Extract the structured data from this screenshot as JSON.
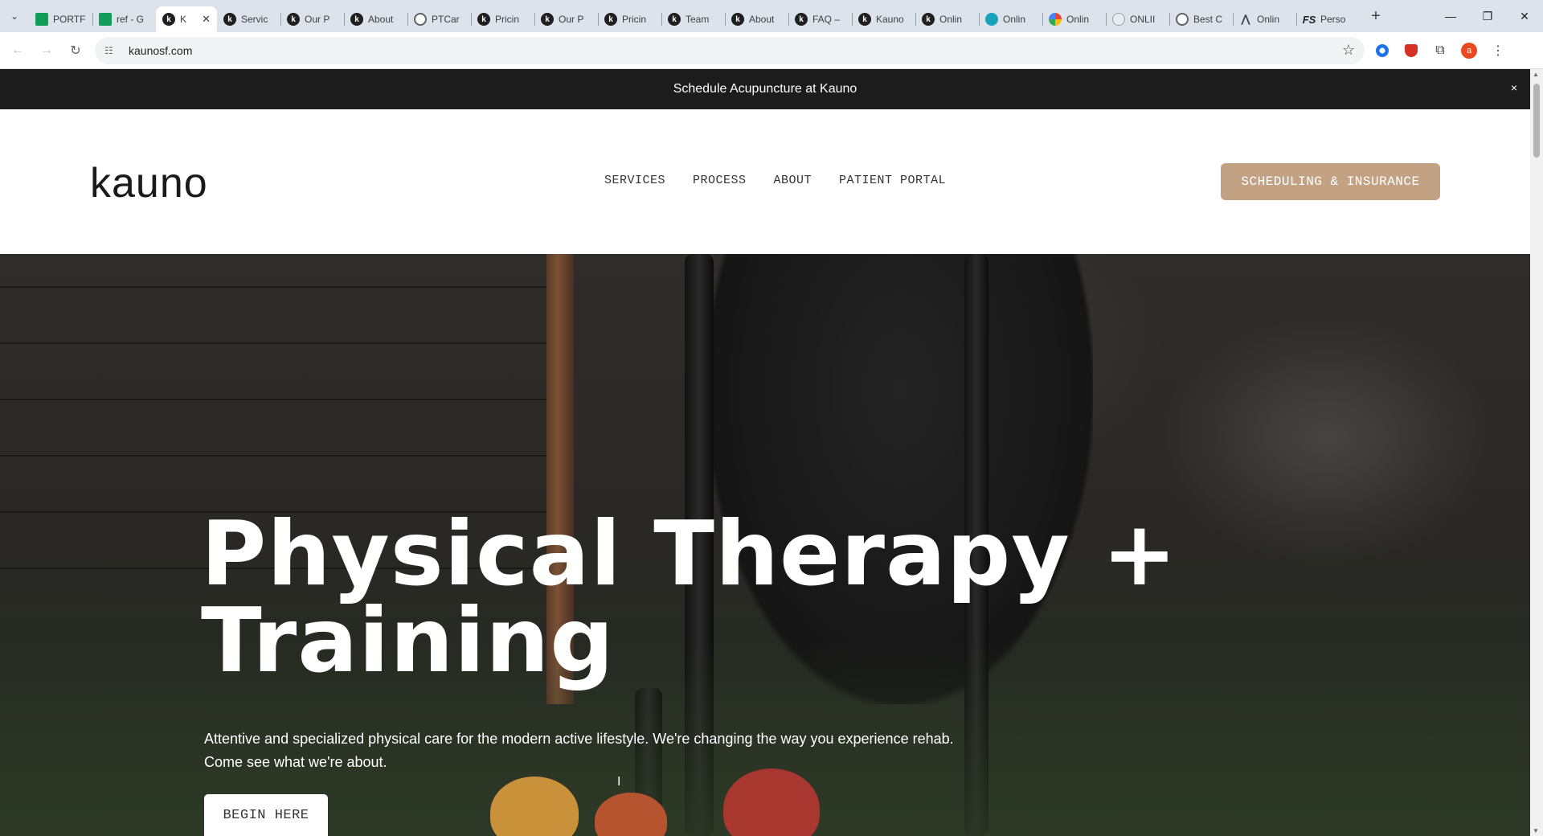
{
  "browser": {
    "tabs": [
      {
        "title": "PORTF",
        "icon": "sheets-icon",
        "iconClass": "ic-sheet",
        "glyph": "",
        "active": false
      },
      {
        "title": "ref - G",
        "icon": "sheets-icon",
        "iconClass": "ic-sheet",
        "glyph": "",
        "active": false
      },
      {
        "title": "K",
        "icon": "kauno-icon",
        "iconClass": "ic-k",
        "glyph": "k",
        "active": true
      },
      {
        "title": "Servic",
        "icon": "kauno-icon",
        "iconClass": "ic-k",
        "glyph": "k",
        "active": false
      },
      {
        "title": "Our P",
        "icon": "kauno-icon",
        "iconClass": "ic-k",
        "glyph": "k",
        "active": false
      },
      {
        "title": "About",
        "icon": "kauno-icon",
        "iconClass": "ic-k",
        "glyph": "k",
        "active": false
      },
      {
        "title": "PTCar",
        "icon": "globe-icon",
        "iconClass": "ic-globe",
        "glyph": "",
        "active": false
      },
      {
        "title": "Pricin",
        "icon": "kauno-icon",
        "iconClass": "ic-k",
        "glyph": "k",
        "active": false
      },
      {
        "title": "Our P",
        "icon": "kauno-icon",
        "iconClass": "ic-k",
        "glyph": "k",
        "active": false
      },
      {
        "title": "Pricin",
        "icon": "kauno-icon",
        "iconClass": "ic-k",
        "glyph": "k",
        "active": false
      },
      {
        "title": "Team",
        "icon": "kauno-icon",
        "iconClass": "ic-k",
        "glyph": "k",
        "active": false
      },
      {
        "title": "About",
        "icon": "kauno-icon",
        "iconClass": "ic-k",
        "glyph": "k",
        "active": false
      },
      {
        "title": "FAQ –",
        "icon": "kauno-icon",
        "iconClass": "ic-k",
        "glyph": "k",
        "active": false
      },
      {
        "title": "Kauno",
        "icon": "kauno-icon",
        "iconClass": "ic-k",
        "glyph": "k",
        "active": false
      },
      {
        "title": "Onlin",
        "icon": "kauno-icon",
        "iconClass": "ic-k",
        "glyph": "k",
        "active": false
      },
      {
        "title": "Onlin",
        "icon": "teal-logo-icon",
        "iconClass": "ic-teal",
        "glyph": "",
        "active": false
      },
      {
        "title": "Onlin",
        "icon": "google-icon",
        "iconClass": "ic-google",
        "glyph": "",
        "active": false
      },
      {
        "title": "ONLII",
        "icon": "grey-logo-icon",
        "iconClass": "ic-grey",
        "glyph": "",
        "active": false
      },
      {
        "title": "Best C",
        "icon": "globe-icon",
        "iconClass": "ic-globe",
        "glyph": "",
        "active": false
      },
      {
        "title": "Onlin",
        "icon": "peak-logo-icon",
        "iconClass": "ic-outline",
        "glyph": "⋀",
        "active": false
      },
      {
        "title": "Perso",
        "icon": "fs-logo-icon",
        "iconClass": "ic-fs",
        "glyph": "FS",
        "active": false
      }
    ],
    "url": "kaunosf.com",
    "profile_initial": "a"
  },
  "announcement": {
    "text": "Schedule Acupuncture at Kauno",
    "close": "×"
  },
  "header": {
    "logo": "kauno",
    "nav": [
      "SERVICES",
      "PROCESS",
      "ABOUT",
      "PATIENT PORTAL"
    ],
    "cta": "SCHEDULING & INSURANCE"
  },
  "hero": {
    "title_line1": "Physical Therapy +",
    "title_line2": "Training",
    "subtitle_line1": "Attentive and specialized physical care for the modern active lifestyle. We're changing the way you experience rehab.",
    "subtitle_line2": "Come see what we're about.",
    "button": "BEGIN HERE"
  },
  "colors": {
    "accent": "#c3a284",
    "announcement_bg": "#1c1c1c"
  }
}
